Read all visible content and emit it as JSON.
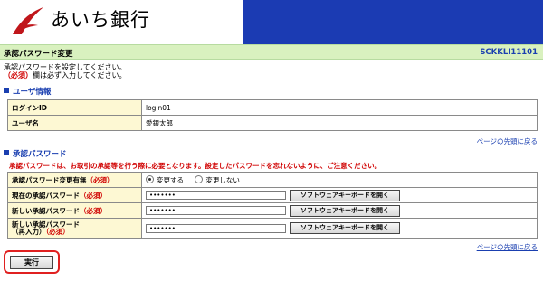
{
  "header": {
    "bank_name": "あいち銀行",
    "logo_color": "#c0161b",
    "band_color": "#1b3bb3"
  },
  "titlebar": {
    "title": "承認パスワード変更",
    "screen_code": "SCKKLI11101"
  },
  "notice": {
    "line1": "承認パスワードを設定してください。",
    "required_mark": "（必須）",
    "line2_suffix": "欄は必ず入力してください。"
  },
  "user_section": {
    "title": "ユーザ情報",
    "rows": [
      {
        "label": "ログインID",
        "value": "login01"
      },
      {
        "label": "ユーザ名",
        "value": "愛銀太郎"
      }
    ],
    "top_link": "ページの先頭に戻る"
  },
  "pw_section": {
    "title": "承認パスワード",
    "warning": "承認パスワードは、お取引の承認等を行う際に必要となります。設定したパスワードを忘れないように、ご注意ください。",
    "change_row": {
      "label": "承認パスワード変更有無",
      "required": "（必須）",
      "option_yes": "変更する",
      "option_no": "変更しない",
      "selected": "変更する"
    },
    "current_row": {
      "label": "現在の承認パスワード",
      "required": "（必須）",
      "value": "•••••••",
      "keyboard_button": "ソフトウェアキーボードを開く"
    },
    "new_row": {
      "label": "新しい承認パスワード",
      "required": "（必須）",
      "value": "•••••••",
      "keyboard_button": "ソフトウェアキーボードを開く"
    },
    "confirm_row": {
      "label_line1": "新しい承認パスワード",
      "label_line2": "（再入力）",
      "required": "（必須）",
      "value": "•••••••",
      "keyboard_button": "ソフトウェアキーボードを開く"
    },
    "top_link": "ページの先頭に戻る"
  },
  "actions": {
    "execute_label": "実行",
    "highlight_color": "#e02020"
  }
}
